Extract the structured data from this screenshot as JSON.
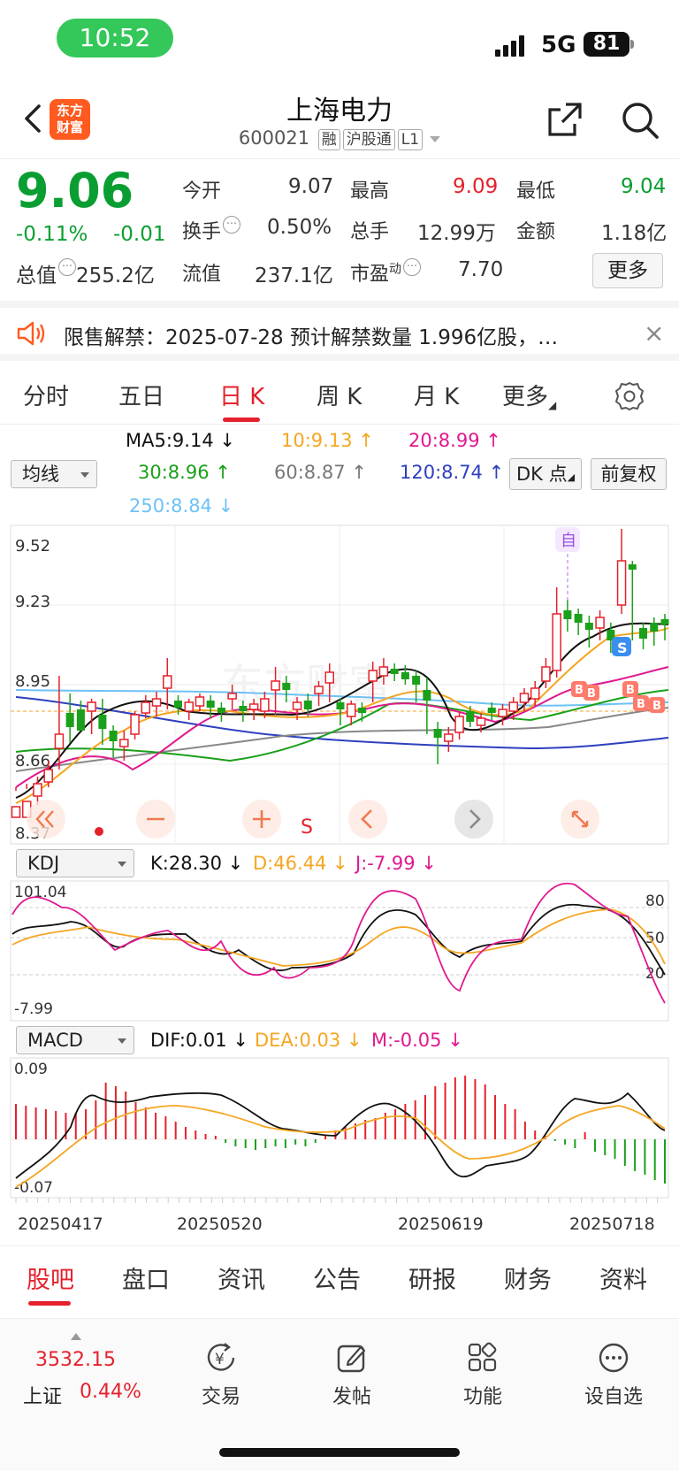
{
  "status_bar": {
    "time": "10:52",
    "network": "5G",
    "battery": "81"
  },
  "header": {
    "logo_text": [
      "东方",
      "财富"
    ],
    "stock_name": "上海电力",
    "stock_code": "600021",
    "tags": [
      "融",
      "沪股通",
      "L1"
    ]
  },
  "quote": {
    "price": "9.06",
    "change_pct": "-0.11%",
    "change_abs": "-0.01",
    "total_value_label": "总值",
    "total_value": "255.2亿",
    "open_label": "今开",
    "open": "9.07",
    "high_label": "最高",
    "high": "9.09",
    "low_label": "最低",
    "low": "9.04",
    "turnover_label": "换手",
    "turnover": "0.50%",
    "volume_label": "总手",
    "volume": "12.99万",
    "amount_label": "金额",
    "amount": "1.18亿",
    "float_label": "流值",
    "float_value": "237.1亿",
    "pe_label": "市盈",
    "pe_sup": "动",
    "pe": "7.70",
    "more_label": "更多"
  },
  "notice": {
    "text": "限售解禁：2025-07-28 预计解禁数量 1.996亿股，…",
    "close": "×"
  },
  "kline_tabs": {
    "items": [
      "分时",
      "五日",
      "日 K",
      "周 K",
      "月 K",
      "更多"
    ],
    "active": "日 K"
  },
  "ma": {
    "select_label": "均线",
    "ma5": "MA5:9.14",
    "ma10": "10:9.13",
    "ma20": "20:8.99",
    "ma30": "30:8.96",
    "ma60": "60:8.87",
    "ma120": "120:8.74",
    "ma250": "250:8.84",
    "dk_label": "DK 点",
    "adjust_label": "前复权",
    "colors": {
      "ma5": "#111111",
      "ma10": "#f5a623",
      "ma20": "#e0198f",
      "ma30": "#1aa01a",
      "ma60": "#888888",
      "ma120": "#2e3fbf",
      "ma250": "#6ec1f5"
    }
  },
  "kchart": {
    "price_labels": [
      "9.52",
      "9.23",
      "8.95",
      "8.66",
      "8.37"
    ],
    "marker_text": "自",
    "s_badge": "S",
    "b_badge": "B",
    "s_label": "S",
    "watermark": "东方财富"
  },
  "kdj": {
    "select_label": "KDJ",
    "k": "K:28.30",
    "d": "D:46.44",
    "j": "J:-7.99",
    "top_label": "101.04",
    "bottom_label": "-7.99",
    "levels": [
      "80",
      "50",
      "20"
    ]
  },
  "macd": {
    "select_label": "MACD",
    "dif": "DIF:0.01",
    "dea": "DEA:0.03",
    "m": "M:-0.05",
    "top_label": "0.09",
    "bottom_label": "-0.07"
  },
  "dates": [
    "20250417",
    "20250520",
    "20250619",
    "20250718"
  ],
  "bottom_tabs": {
    "items": [
      "股吧",
      "盘口",
      "资讯",
      "公告",
      "研报",
      "财务",
      "资料"
    ],
    "active": "股吧"
  },
  "toolbar": {
    "index_value": "3532.15",
    "index_name": "上证",
    "index_pct": "0.44%",
    "items": [
      "交易",
      "发帖",
      "功能",
      "设自选"
    ]
  }
}
